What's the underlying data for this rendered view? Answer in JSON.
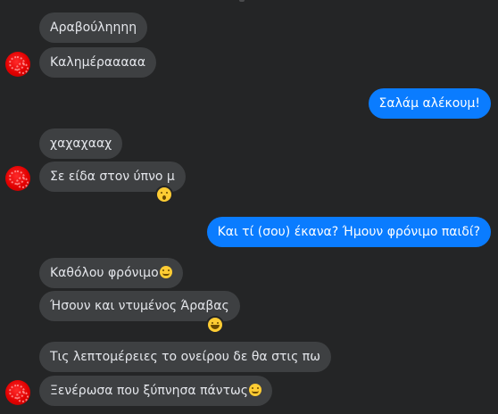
{
  "messages": [
    {
      "id": "m1",
      "side": "in",
      "text": "Αραβούληηηη"
    },
    {
      "id": "m2",
      "side": "in",
      "text": "Καλημέρααααα"
    },
    {
      "id": "m3",
      "side": "out",
      "text": "Σαλάμ αλέκουμ!"
    },
    {
      "id": "m4",
      "side": "in",
      "text": "χαχαχααχ"
    },
    {
      "id": "m5",
      "side": "in",
      "text": "Σε είδα στον ύπνο μ",
      "reaction": "astonished-face-icon"
    },
    {
      "id": "m6",
      "side": "out",
      "text": "Και τί (σου) έκανα? Ήμουν φρόνιμο παιδί?"
    },
    {
      "id": "m7",
      "side": "in",
      "text": "Καθόλου φρόνιμο",
      "inline_emoji": "smiling-face-icon"
    },
    {
      "id": "m8",
      "side": "in",
      "text": "Ήσουν και ντυμένος Άραβας",
      "reaction": "grinning-squinting-face-icon"
    },
    {
      "id": "m9",
      "side": "in",
      "text": "Τις λεπτομέρειες το ονείρου δε θα στις πω"
    },
    {
      "id": "m10",
      "side": "in",
      "text": "Ξενέρωσα που ξύπνησα πάντως",
      "inline_emoji": "pensive-face-icon"
    }
  ],
  "colors": {
    "background": "#242526",
    "incoming_bubble": "#3e4042",
    "outgoing_bubble": "#0a7cff",
    "avatar": "#e10000"
  }
}
